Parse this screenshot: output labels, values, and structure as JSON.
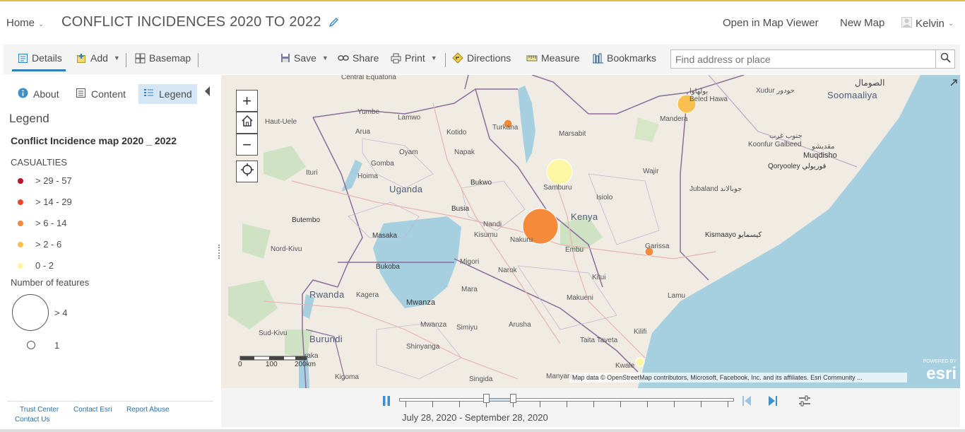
{
  "header": {
    "home_label": "Home",
    "title": "CONFLICT INCIDENCES 2020 TO 2022",
    "open_in_map_viewer": "Open in Map Viewer",
    "new_map": "New Map",
    "user_name": "Kelvin"
  },
  "toolbar": {
    "details": "Details",
    "add": "Add",
    "basemap": "Basemap",
    "save": "Save",
    "share": "Share",
    "print": "Print",
    "directions": "Directions",
    "measure": "Measure",
    "bookmarks": "Bookmarks",
    "search_placeholder": "Find address or place"
  },
  "sidebar": {
    "tabs": [
      "About",
      "Content",
      "Legend"
    ],
    "active_tab": "Legend",
    "legend_heading": "Legend",
    "layer_title": "Conflict Incidence map 2020 _ 2022",
    "field_title": "CASUALTIES",
    "classes": [
      {
        "label": "> 29 - 57",
        "color": "#c2112a"
      },
      {
        "label": "> 14 - 29",
        "color": "#e84a2c"
      },
      {
        "label": "> 6 - 14",
        "color": "#f58a3a"
      },
      {
        "label": "> 2 - 6",
        "color": "#f9c04f"
      },
      {
        "label": "0 - 2",
        "color": "#fdf7a3"
      }
    ],
    "size_title": "Number of features",
    "size_large_label": "> 4",
    "size_small_label": "1",
    "footer_links": [
      "Trust Center",
      "Contact Esri",
      "Report Abuse",
      "Contact Us"
    ]
  },
  "map": {
    "labels": {
      "central_equatoria": "Central Equatoria",
      "yumbe": "Yumbe",
      "lamwo": "Lamwo",
      "haut_uele": "Haut-Uele",
      "arua": "Arua",
      "kotido": "Kotido",
      "turkana": "Turkana",
      "marsabit": "Marsabit",
      "mandera": "Mandera",
      "beled_hawa": "بولهاوا\nBeled Hawa",
      "xudur": "Xudur حودور",
      "somaliya_ar": "الصومال",
      "soomaaliya": "Soomaaliya",
      "koonfur_ar": "جنوب غرب",
      "koonfur": "Koonfur Galbeed",
      "muqdisho_ar": "مقديشو",
      "muqdisho": "Muqdisho",
      "qoryooley": "Qoryooley قوريولي",
      "oyam": "Oyam",
      "napak": "Napak",
      "ituri": "Ituri",
      "gomba": "Gomba",
      "uganda": "Uganda",
      "hoima": "Hoima",
      "bukwo": "Bukwo",
      "busia": "Busia",
      "samburu": "Samburu",
      "wajir": "Wajir",
      "isiolo": "Isiolo",
      "jubaland": "Jubaland جوبالاند",
      "kenya": "Kenya",
      "butembo": "Butembo",
      "masaka": "Masaka",
      "kisumu": "Kisumu",
      "nandi": "Nandi",
      "nakuru": "Nakuru",
      "embu": "Embu",
      "garissa": "Garissa",
      "kismaayo": "Kismaayo كيسمايو",
      "nord_kivu": "Nord-Kivu",
      "bukoba": "Bukoba",
      "migori": "Migori",
      "narok": "Narok",
      "kitui": "Kitui",
      "rwanda": "Rwanda",
      "kagera": "Kagera",
      "mara": "Mara",
      "lamu": "Lamu",
      "mwanza": "Mwanza",
      "makueni": "Makueni",
      "sud_kivu": "Sud-Kivu",
      "mwanza2": "Mwanza",
      "simiyu": "Simiyu",
      "arusha": "Arusha",
      "kilifi": "Kilifi",
      "burundi": "Burundi",
      "shinyanga": "Shinyanga",
      "taita": "Taita Taveta",
      "kigoma": "Kigoma",
      "singida": "Singida",
      "manyara": "Manyara",
      "kwale": "Kwale",
      "raka": "raka"
    },
    "scale": {
      "tick0": "0",
      "tick1": "100",
      "tick2": "200km"
    },
    "attribution": "Map data © OpenStreetMap contributors, Microsoft, Facebook, Inc. and its affiliates. Esri Community ...",
    "esri_powered": "POWERED BY",
    "esri_logo": "esri",
    "points": [
      {
        "name": "turkana",
        "casualties_class": "> 6 - 14",
        "features": 1,
        "color": "#f58a3a"
      },
      {
        "name": "mandera",
        "casualties_class": "> 2 - 6",
        "features": 2,
        "color": "#f9c04f"
      },
      {
        "name": "samburu",
        "casualties_class": "0 - 2",
        "features": 3,
        "color": "#fdf7a3"
      },
      {
        "name": "nakuru",
        "casualties_class": "> 6 - 14",
        "features": 5,
        "color": "#f58a3a"
      },
      {
        "name": "garissa",
        "casualties_class": "> 6 - 14",
        "features": 1,
        "color": "#f58a3a"
      },
      {
        "name": "kwale",
        "casualties_class": "0 - 2",
        "features": 1,
        "color": "#fdf7a3"
      }
    ]
  },
  "time_slider": {
    "range_label": "July 28, 2020 - September 28, 2020"
  }
}
